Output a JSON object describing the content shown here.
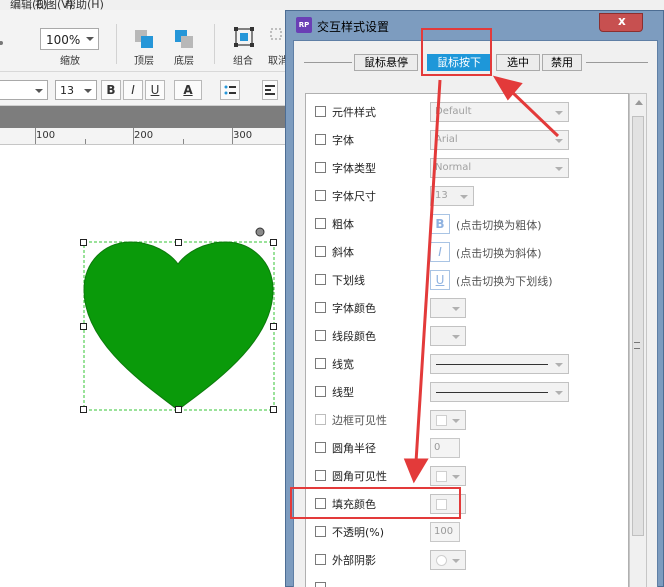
{
  "app": {
    "menu": [
      "编辑(E)",
      "视图(V)",
      "帮助(H)"
    ],
    "toolbar": {
      "zoom_value": "100%",
      "zoom_label": "缩放",
      "top_layer_label": "顶层",
      "bottom_layer_label": "底层",
      "group_label": "组合",
      "ungroup_label": "取消组合"
    },
    "format_bar": {
      "font_size": "13",
      "bold_label": "B",
      "italic_label": "I",
      "underline_label": "U",
      "font_color_label": "A"
    },
    "ruler": [
      "100",
      "200",
      "300"
    ],
    "shape": {
      "type": "heart",
      "fill_color": "#0a9a0a"
    }
  },
  "dialog": {
    "title": "交互样式设置",
    "close_label": "x",
    "tabs": [
      {
        "label": "鼠标悬停",
        "active": false
      },
      {
        "label": "鼠标按下",
        "active": true
      },
      {
        "label": "选中",
        "active": false
      },
      {
        "label": "禁用",
        "active": false
      }
    ],
    "rows": [
      {
        "label": "元件样式",
        "value": "Default",
        "control": "dropdown"
      },
      {
        "label": "字体",
        "value": "Arial",
        "control": "dropdown"
      },
      {
        "label": "字体类型",
        "value": "Normal",
        "control": "dropdown"
      },
      {
        "label": "字体尺寸",
        "value": "13",
        "control": "dropdown-small"
      },
      {
        "label": "粗体",
        "value": "B",
        "hint": "(点击切换为粗体)",
        "control": "toggle"
      },
      {
        "label": "斜体",
        "value": "I",
        "hint": "(点击切换为斜体)",
        "control": "toggle"
      },
      {
        "label": "下划线",
        "value": "U",
        "hint": "(点击切换为下划线)",
        "control": "toggle"
      },
      {
        "label": "字体颜色",
        "value": "",
        "control": "color"
      },
      {
        "label": "线段颜色",
        "value": "",
        "control": "color"
      },
      {
        "label": "线宽",
        "value": "",
        "control": "line"
      },
      {
        "label": "线型",
        "value": "",
        "control": "line"
      },
      {
        "label": "边框可见性",
        "value": "",
        "control": "color"
      },
      {
        "label": "圆角半径",
        "value": "0",
        "control": "number"
      },
      {
        "label": "圆角可见性",
        "value": "",
        "control": "color"
      },
      {
        "label": "填充颜色",
        "value": "",
        "control": "color"
      },
      {
        "label": "不透明(%)",
        "value": "100",
        "control": "number"
      },
      {
        "label": "外部阴影",
        "value": "",
        "control": "color"
      }
    ]
  },
  "colors": {
    "active_tab": "#1e97d9",
    "annotation_red": "#e33a3a",
    "heart_green": "#0a9a0a"
  }
}
